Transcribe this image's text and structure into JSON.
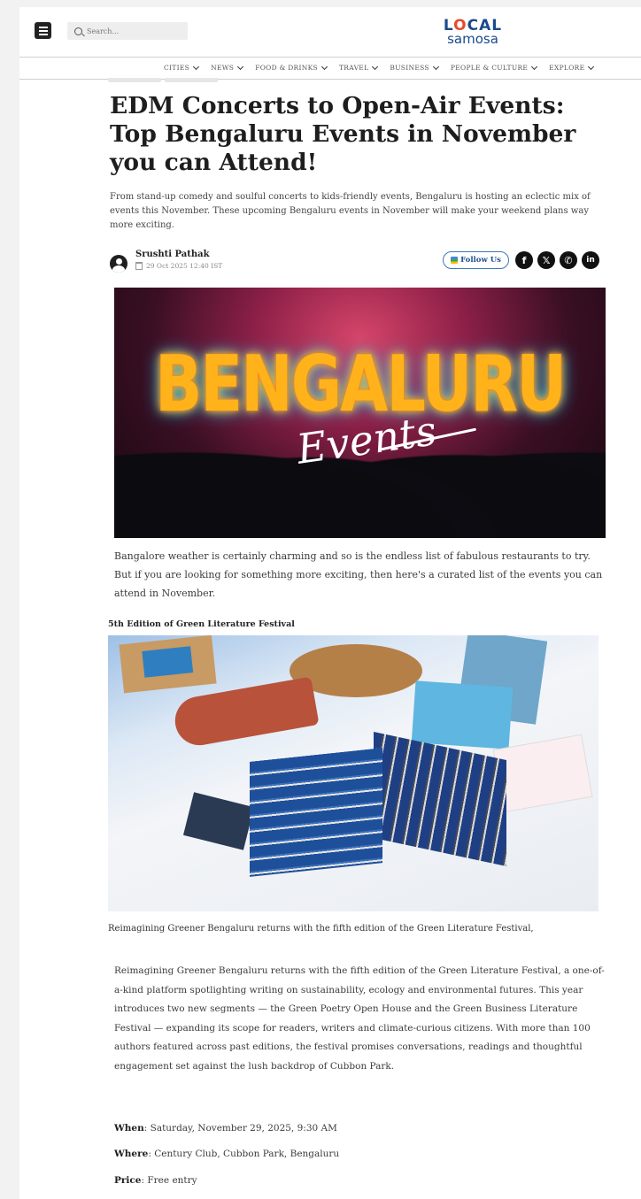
{
  "header": {
    "search_placeholder": "Search...",
    "logo_top": "LOCAL",
    "logo_bottom": "samosa",
    "nav": [
      "CITIES",
      "NEWS",
      "FOOD & DRINKS",
      "TRAVEL",
      "BUSINESS",
      "PEOPLE & CULTURE",
      "EXPLORE"
    ]
  },
  "article": {
    "title": "EDM Concerts to Open-Air Events: Top Bengaluru Events in November you can Attend!",
    "deck": "From stand-up comedy and soulful concerts to kids-friendly events, Bengaluru is hosting an eclectic mix of events this November. These upcoming Bengaluru events in November will make your weekend plans way more exciting.",
    "author": "Srushti Pathak",
    "date": "29 Oct 2025 12:40 IST",
    "follow_label": "Follow Us",
    "hero_word": "BENGALURU",
    "hero_script": "Events",
    "intro": "Bangalore weather is certainly charming and so is the endless list of fabulous restaurants to try. But if you are looking for something more exciting, then here's a curated list of the events you can attend in November.",
    "section_heading": "5th Edition of Green Literature Festival",
    "caption": "Reimagining Greener Bengaluru returns with the fifth edition of the Green Literature Festival,",
    "body": "Reimagining Greener Bengaluru returns with the fifth edition of the Green Literature Festival, a one-of-a-kind platform spotlighting writing on sustainability, ecology and environmental futures. This year introduces two new segments — the Green Poetry Open House and the Green Business Literature Festival — expanding its scope for readers, writers and climate-curious citizens. With more than 100 authors featured across past editions, the festival promises conversations, readings and thoughtful engagement set against the lush backdrop of Cubbon Park.",
    "when_label": "When",
    "when_value": ": Saturday, November 29, 2025, 9:30 AM",
    "where_label": "Where",
    "where_value": ": Century Club, Cubbon Park, Bengaluru",
    "price_label": "Price",
    "price_value": ": Free entry"
  },
  "icons": {
    "social": [
      "facebook-icon",
      "x-icon",
      "whatsapp-icon",
      "linkedin-icon"
    ]
  },
  "colors": {
    "logo_blue": "#1a4a8c",
    "logo_orange": "#e64a2e",
    "follow_border": "#3c7ab8"
  }
}
